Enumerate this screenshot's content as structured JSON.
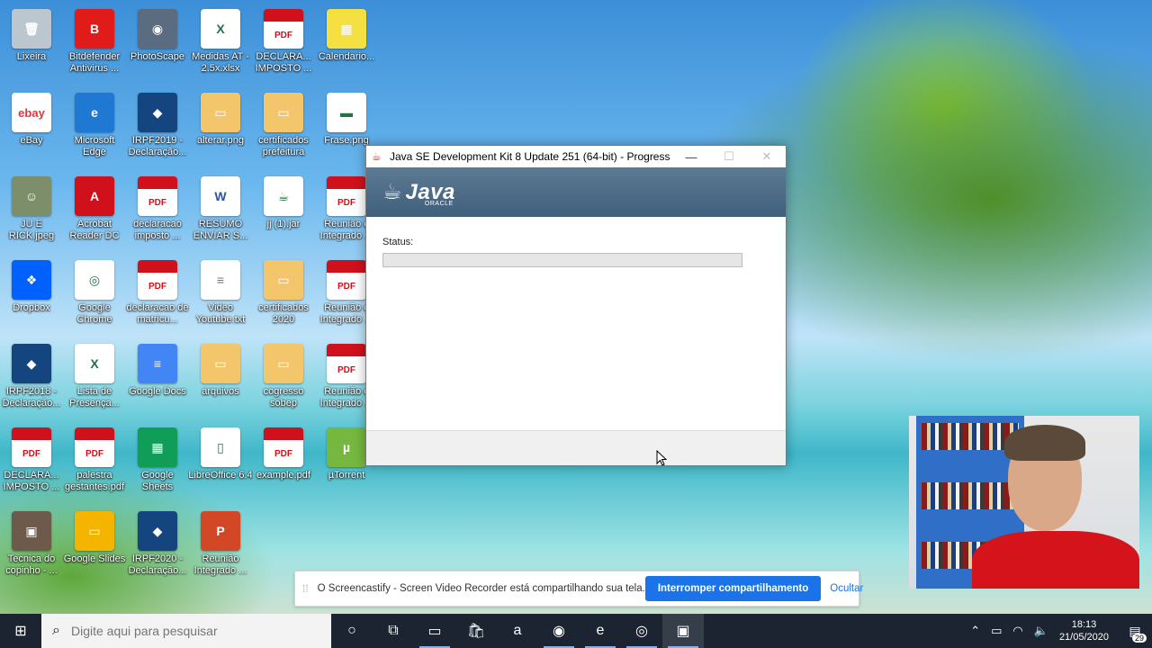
{
  "desktop": {
    "icons": [
      {
        "label": "Lixeira",
        "glyph": "🗑",
        "color": "#bcc6cf"
      },
      {
        "label": "Bitdefender Antivirus ...",
        "glyph": "B",
        "color": "#e11a1a"
      },
      {
        "label": "PhotoScape",
        "glyph": "◉",
        "color": "#5b6c80"
      },
      {
        "label": "Medidas AT - 2.5x.xlsx",
        "glyph": "X",
        "color": "#ffffff"
      },
      {
        "label": "DECLARA... IMPOSTO ...",
        "glyph": "PDF",
        "color": "#ffffff"
      },
      {
        "label": "Calendario...",
        "glyph": "▦",
        "color": "#f5e042"
      },
      {
        "label": "eBay",
        "glyph": "ebay",
        "color": "#ffffff"
      },
      {
        "label": "Microsoft Edge",
        "glyph": "e",
        "color": "#1f78d1"
      },
      {
        "label": "IRPF2019 - Declaração...",
        "glyph": "◆",
        "color": "#14457e"
      },
      {
        "label": "alterar.png",
        "glyph": "▭",
        "color": "#f3c66b"
      },
      {
        "label": "certificados prefeitura",
        "glyph": "▭",
        "color": "#f3c66b"
      },
      {
        "label": "Frase.png",
        "glyph": "▬",
        "color": "#ffffff"
      },
      {
        "label": "JU E RICK.jpeg",
        "glyph": "☺",
        "color": "#7c8f6a"
      },
      {
        "label": "Acrobat Reader DC",
        "glyph": "A",
        "color": "#d0101b"
      },
      {
        "label": "declaracao imposto ...",
        "glyph": "PDF",
        "color": "#ffffff"
      },
      {
        "label": "RESUMO ENVIAR S...",
        "glyph": "W",
        "color": "#ffffff"
      },
      {
        "label": "jj (1).jar",
        "glyph": "☕",
        "color": "#ffffff"
      },
      {
        "label": "Reunião c Integrado ...",
        "glyph": "PDF",
        "color": "#ffffff"
      },
      {
        "label": "Dropbox",
        "glyph": "❖",
        "color": "#0061fe"
      },
      {
        "label": "Google Chrome",
        "glyph": "◎",
        "color": "#ffffff"
      },
      {
        "label": "declaracao de matricu...",
        "glyph": "PDF",
        "color": "#ffffff"
      },
      {
        "label": "Video Youtube.txt",
        "glyph": "≡",
        "color": "#ffffff"
      },
      {
        "label": "certificados 2020",
        "glyph": "▭",
        "color": "#f3c66b"
      },
      {
        "label": "Reunião c Integrado ...",
        "glyph": "PDF",
        "color": "#ffffff"
      },
      {
        "label": "IRPF2018 - Declaração...",
        "glyph": "◆",
        "color": "#14457e"
      },
      {
        "label": "Lista de Presença...",
        "glyph": "X",
        "color": "#ffffff"
      },
      {
        "label": "Google Docs",
        "glyph": "≡",
        "color": "#4285f4"
      },
      {
        "label": "arquivos",
        "glyph": "▭",
        "color": "#f3c66b"
      },
      {
        "label": "cogresso sobep",
        "glyph": "▭",
        "color": "#f3c66b"
      },
      {
        "label": "Reunião c Integrado ...",
        "glyph": "PDF",
        "color": "#ffffff"
      },
      {
        "label": "DECLARA... IMPOSTO ...",
        "glyph": "PDF",
        "color": "#ffffff"
      },
      {
        "label": "palestra gestantes.pdf",
        "glyph": "PDF",
        "color": "#ffffff"
      },
      {
        "label": "Google Sheets",
        "glyph": "▦",
        "color": "#0f9d58"
      },
      {
        "label": "LibreOffice 6.4",
        "glyph": "▯",
        "color": "#ffffff"
      },
      {
        "label": "example.pdf",
        "glyph": "PDF",
        "color": "#ffffff"
      },
      {
        "label": "µTorrent",
        "glyph": "µ",
        "color": "#76b83f"
      },
      {
        "label": "Tecnica do copinho - ...",
        "glyph": "▣",
        "color": "#6d5a4a"
      },
      {
        "label": "Google Slides",
        "glyph": "▭",
        "color": "#f4b400"
      },
      {
        "label": "IRPF2020 - Declaração...",
        "glyph": "◆",
        "color": "#14457e"
      },
      {
        "label": "Reunião Integrado ...",
        "glyph": "P",
        "color": "#d24726"
      }
    ]
  },
  "dialog": {
    "title": "Java SE Development Kit 8 Update 251 (64-bit) - Progress",
    "minimize": "—",
    "maximize": "☐",
    "close": "✕",
    "brand": "Java",
    "brand_sub": "ORACLE",
    "status_label": "Status:",
    "progress_percent": 0
  },
  "screencastify": {
    "handle": "⁞⁞",
    "message": "O Screencastify - Screen Video Recorder está compartilhando sua tela.",
    "stop_label": "Interromper compartilhamento",
    "hide_label": "Ocultar"
  },
  "taskbar": {
    "start_glyph": "⊞",
    "search_placeholder": "Digite aqui para pesquisar",
    "apps": [
      {
        "name": "cortana",
        "glyph": "○"
      },
      {
        "name": "task-view",
        "glyph": "⧉"
      },
      {
        "name": "file-explorer",
        "glyph": "▭"
      },
      {
        "name": "store",
        "glyph": "🛍"
      },
      {
        "name": "amazon",
        "glyph": "a"
      },
      {
        "name": "firefox",
        "glyph": "◉"
      },
      {
        "name": "edge",
        "glyph": "e"
      },
      {
        "name": "chrome",
        "glyph": "◎"
      },
      {
        "name": "java-installer",
        "glyph": "▣"
      }
    ],
    "time": "18:13",
    "date": "21/05/2020",
    "notification_count": "29"
  }
}
